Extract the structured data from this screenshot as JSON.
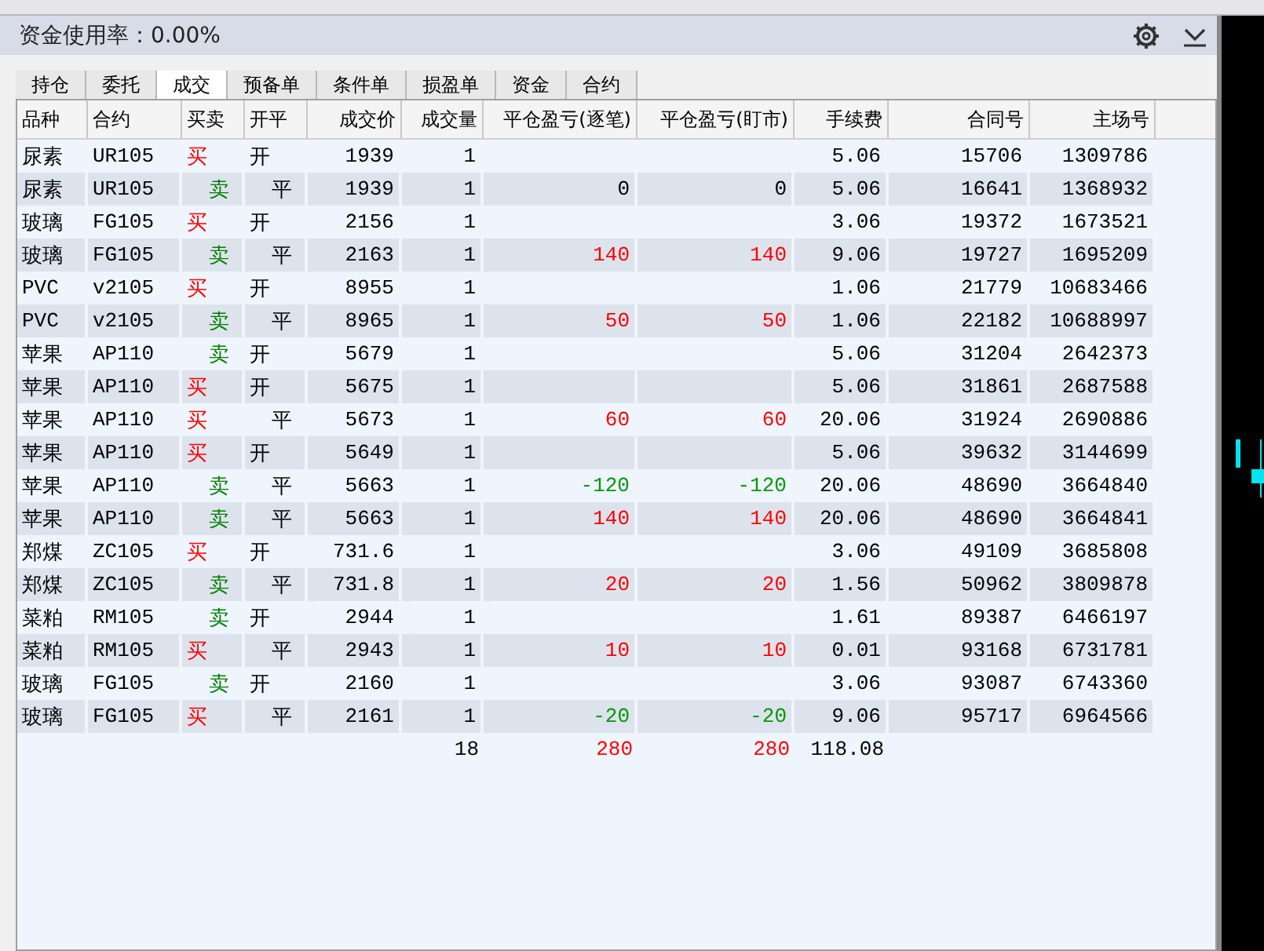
{
  "window": {
    "title": "资金使用率：0.00%"
  },
  "tabs": [
    {
      "label": "持仓",
      "selected": false
    },
    {
      "label": "委托",
      "selected": false
    },
    {
      "label": "成交",
      "selected": true
    },
    {
      "label": "预备单",
      "selected": false
    },
    {
      "label": "条件单",
      "selected": false
    },
    {
      "label": "损盈单",
      "selected": false
    },
    {
      "label": "资金",
      "selected": false
    },
    {
      "label": "合约",
      "selected": false
    }
  ],
  "table": {
    "columns": [
      "品种",
      "合约",
      "买卖",
      "开平",
      "成交价",
      "成交量",
      "平仓盈亏(逐笔)",
      "平仓盈亏(盯市)",
      "手续费",
      "合同号",
      "主场号"
    ],
    "rows": [
      {
        "product": "尿素",
        "contract": "UR105",
        "side": "买",
        "sell": false,
        "offset": "开",
        "close": false,
        "price": "1939",
        "qty": "1",
        "fee": "5.06",
        "contract_no": "15706",
        "exchange_no": "1309786"
      },
      {
        "product": "尿素",
        "contract": "UR105",
        "side": "卖",
        "sell": true,
        "offset": "平",
        "close": true,
        "price": "1939",
        "qty": "1",
        "pnl_trade": "0",
        "pnl_mark": "0",
        "color": "#000000",
        "fee": "5.06",
        "contract_no": "16641",
        "exchange_no": "1368932"
      },
      {
        "product": "玻璃",
        "contract": "FG105",
        "side": "买",
        "sell": false,
        "offset": "开",
        "close": false,
        "price": "2156",
        "qty": "1",
        "fee": "3.06",
        "contract_no": "19372",
        "exchange_no": "1673521"
      },
      {
        "product": "玻璃",
        "contract": "FG105",
        "side": "卖",
        "sell": true,
        "offset": "平",
        "close": true,
        "price": "2163",
        "qty": "1",
        "pnl_trade": "140",
        "pnl_mark": "140",
        "color": "#ff0000",
        "fee": "9.06",
        "contract_no": "19727",
        "exchange_no": "1695209"
      },
      {
        "product": "PVC",
        "contract": "v2105",
        "side": "买",
        "sell": false,
        "offset": "开",
        "close": false,
        "price": "8955",
        "qty": "1",
        "fee": "1.06",
        "contract_no": "21779",
        "exchange_no": "10683466"
      },
      {
        "product": "PVC",
        "contract": "v2105",
        "side": "卖",
        "sell": true,
        "offset": "平",
        "close": true,
        "price": "8965",
        "qty": "1",
        "pnl_trade": "50",
        "pnl_mark": "50",
        "color": "#ff0000",
        "fee": "1.06",
        "contract_no": "22182",
        "exchange_no": "10688997"
      },
      {
        "product": "苹果",
        "contract": "AP110",
        "side": "卖",
        "sell": true,
        "offset": "开",
        "close": false,
        "price": "5679",
        "qty": "1",
        "fee": "5.06",
        "contract_no": "31204",
        "exchange_no": "2642373"
      },
      {
        "product": "苹果",
        "contract": "AP110",
        "side": "买",
        "sell": false,
        "offset": "开",
        "close": false,
        "price": "5675",
        "qty": "1",
        "fee": "5.06",
        "contract_no": "31861",
        "exchange_no": "2687588"
      },
      {
        "product": "苹果",
        "contract": "AP110",
        "side": "买",
        "sell": false,
        "offset": "平",
        "close": true,
        "price": "5673",
        "qty": "1",
        "pnl_trade": "60",
        "pnl_mark": "60",
        "color": "#ff0000",
        "fee": "20.06",
        "contract_no": "31924",
        "exchange_no": "2690886"
      },
      {
        "product": "苹果",
        "contract": "AP110",
        "side": "买",
        "sell": false,
        "offset": "开",
        "close": false,
        "price": "5649",
        "qty": "1",
        "fee": "5.06",
        "contract_no": "39632",
        "exchange_no": "3144699"
      },
      {
        "product": "苹果",
        "contract": "AP110",
        "side": "卖",
        "sell": true,
        "offset": "平",
        "close": true,
        "price": "5663",
        "qty": "1",
        "pnl_trade": "-120",
        "pnl_mark": "-120",
        "color": "#009900",
        "fee": "20.06",
        "contract_no": "48690",
        "exchange_no": "3664840"
      },
      {
        "product": "苹果",
        "contract": "AP110",
        "side": "卖",
        "sell": true,
        "offset": "平",
        "close": true,
        "price": "5663",
        "qty": "1",
        "pnl_trade": "140",
        "pnl_mark": "140",
        "color": "#ff0000",
        "fee": "20.06",
        "contract_no": "48690",
        "exchange_no": "3664841"
      },
      {
        "product": "郑煤",
        "contract": "ZC105",
        "side": "买",
        "sell": false,
        "offset": "开",
        "close": false,
        "price": "731.6",
        "qty": "1",
        "fee": "3.06",
        "contract_no": "49109",
        "exchange_no": "3685808"
      },
      {
        "product": "郑煤",
        "contract": "ZC105",
        "side": "卖",
        "sell": true,
        "offset": "平",
        "close": true,
        "price": "731.8",
        "qty": "1",
        "pnl_trade": "20",
        "pnl_mark": "20",
        "color": "#ff0000",
        "fee": "1.56",
        "contract_no": "50962",
        "exchange_no": "3809878"
      },
      {
        "product": "菜粕",
        "contract": "RM105",
        "side": "卖",
        "sell": true,
        "offset": "开",
        "close": false,
        "price": "2944",
        "qty": "1",
        "fee": "1.61",
        "contract_no": "89387",
        "exchange_no": "6466197"
      },
      {
        "product": "菜粕",
        "contract": "RM105",
        "side": "买",
        "sell": false,
        "offset": "平",
        "close": true,
        "price": "2943",
        "qty": "1",
        "pnl_trade": "10",
        "pnl_mark": "10",
        "color": "#ff0000",
        "fee": "0.01",
        "contract_no": "93168",
        "exchange_no": "6731781"
      },
      {
        "product": "玻璃",
        "contract": "FG105",
        "side": "卖",
        "sell": true,
        "offset": "开",
        "close": false,
        "price": "2160",
        "qty": "1",
        "fee": "3.06",
        "contract_no": "93087",
        "exchange_no": "6743360"
      },
      {
        "product": "玻璃",
        "contract": "FG105",
        "side": "买",
        "sell": false,
        "offset": "平",
        "close": true,
        "price": "2161",
        "qty": "1",
        "pnl_trade": "-20",
        "pnl_mark": "-20",
        "color": "#009900",
        "fee": "9.06",
        "contract_no": "95717",
        "exchange_no": "6964566"
      }
    ],
    "totals": {
      "qty": "18",
      "pnl_trade": "280",
      "pnl_mark": "280",
      "color": "#ff0000",
      "fee": "118.08"
    }
  }
}
